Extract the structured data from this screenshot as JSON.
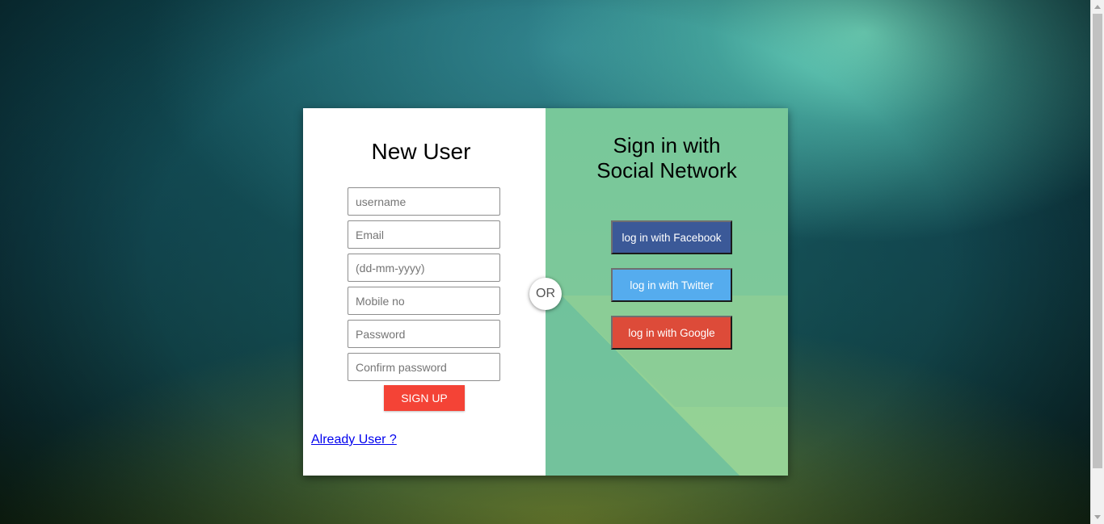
{
  "new_user": {
    "title": "New User",
    "fields": {
      "username": {
        "placeholder": "username",
        "value": ""
      },
      "email": {
        "placeholder": "Email",
        "value": ""
      },
      "dob": {
        "placeholder": "(dd-mm-yyyy)",
        "value": ""
      },
      "mobile": {
        "placeholder": "Mobile no",
        "value": ""
      },
      "password": {
        "placeholder": "Password",
        "value": ""
      },
      "confirm_password": {
        "placeholder": "Confirm password",
        "value": ""
      }
    },
    "signup_label": "SIGN UP",
    "already_user_link": "Already User ?"
  },
  "divider": {
    "label": "OR"
  },
  "social": {
    "title_line1": "Sign in with",
    "title_line2": "Social Network",
    "buttons": {
      "facebook": {
        "label": "log in with Facebook",
        "color": "#3b5998"
      },
      "twitter": {
        "label": "log in with Twitter",
        "color": "#55acee"
      },
      "google": {
        "label": "log in with Google",
        "color": "#dd4b39"
      }
    }
  },
  "colors": {
    "signup_button": "#f44336",
    "social_panel": "#7fc99a",
    "link": "#0000ee"
  }
}
